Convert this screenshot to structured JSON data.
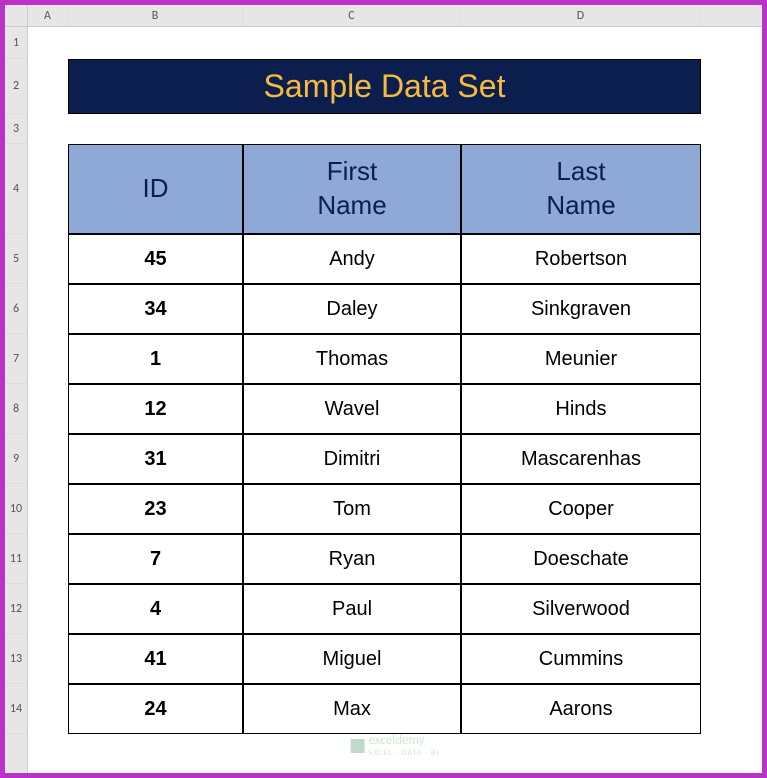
{
  "columns": [
    "A",
    "B",
    "C",
    "D"
  ],
  "rows": [
    "1",
    "2",
    "3",
    "4",
    "5",
    "6",
    "7",
    "8",
    "9",
    "10",
    "11",
    "12",
    "13",
    "14"
  ],
  "title": "Sample Data Set",
  "headers": {
    "id": "ID",
    "first": "First\nName",
    "last": "Last\nName"
  },
  "chart_data": {
    "type": "table",
    "title": "Sample Data Set",
    "columns": [
      "ID",
      "First Name",
      "Last Name"
    ],
    "rows": [
      {
        "id": "45",
        "first": "Andy",
        "last": "Robertson"
      },
      {
        "id": "34",
        "first": "Daley",
        "last": "Sinkgraven"
      },
      {
        "id": "1",
        "first": "Thomas",
        "last": "Meunier"
      },
      {
        "id": "12",
        "first": "Wavel",
        "last": "Hinds"
      },
      {
        "id": "31",
        "first": "Dimitri",
        "last": "Mascarenhas"
      },
      {
        "id": "23",
        "first": "Tom",
        "last": "Cooper"
      },
      {
        "id": "7",
        "first": "Ryan",
        "last": "Doeschate"
      },
      {
        "id": "4",
        "first": "Paul",
        "last": "Silverwood"
      },
      {
        "id": "41",
        "first": "Miguel",
        "last": "Cummins"
      },
      {
        "id": "24",
        "first": "Max",
        "last": "Aarons"
      }
    ]
  },
  "watermark": {
    "brand": "exceldemy",
    "tagline": "EXCEL · DATA · BI"
  }
}
